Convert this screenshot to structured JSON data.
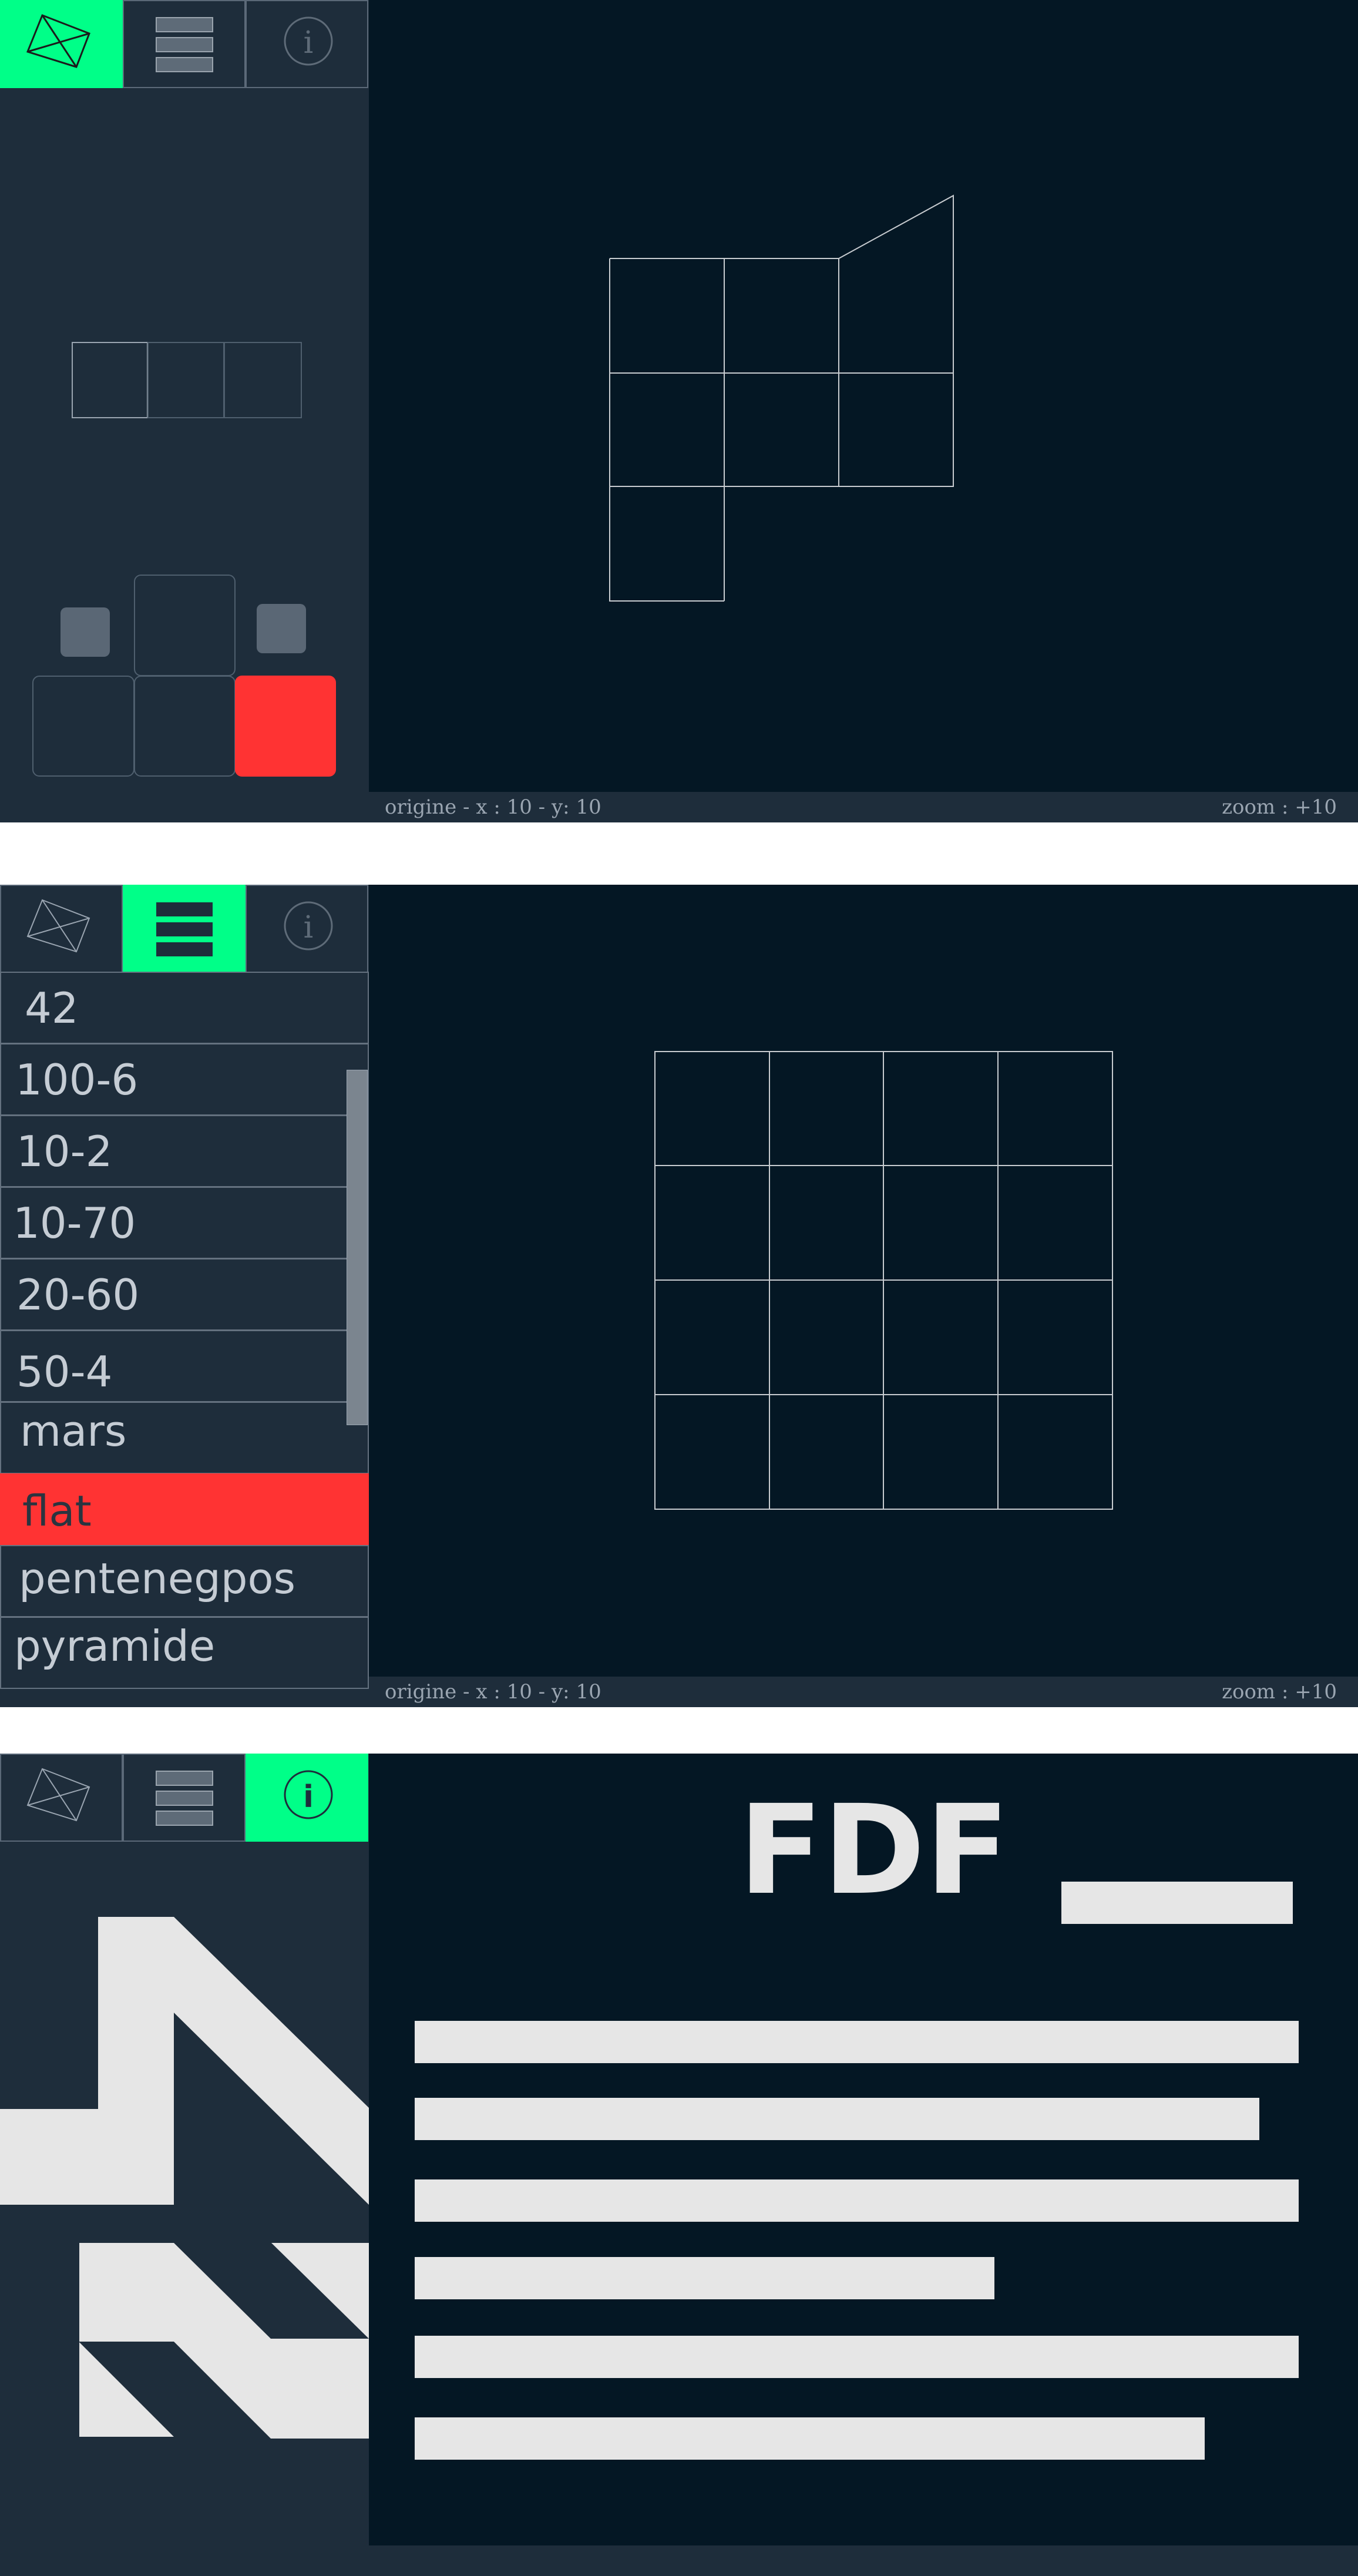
{
  "screens": [
    {
      "active_tab": "draw",
      "status": {
        "origin": "origine - x : 10   -  y: 10",
        "zoom": "zoom : +10"
      }
    },
    {
      "active_tab": "list",
      "list": {
        "items": [
          "42",
          "100-6",
          "10-2",
          "10-70",
          "20-60",
          "50-4",
          "mars",
          "flat",
          "pentenegpos",
          "pyramide"
        ],
        "selected": "flat"
      },
      "status": {
        "origin": "origine - x : 10   -  y: 10",
        "zoom": "zoom : +10"
      }
    },
    {
      "active_tab": "info",
      "info": {
        "title": "FDF"
      }
    }
  ],
  "tabs": {
    "draw": {
      "icon": "wireframe-icon"
    },
    "list": {
      "icon": "list-icon"
    },
    "info": {
      "icon": "info-icon",
      "glyph": "i"
    }
  },
  "colors": {
    "accent": "#00ff88",
    "selected": "#ff3333",
    "canvas": "#041724",
    "panel": "#1e2d3b",
    "wire": "#c8ccd0"
  }
}
